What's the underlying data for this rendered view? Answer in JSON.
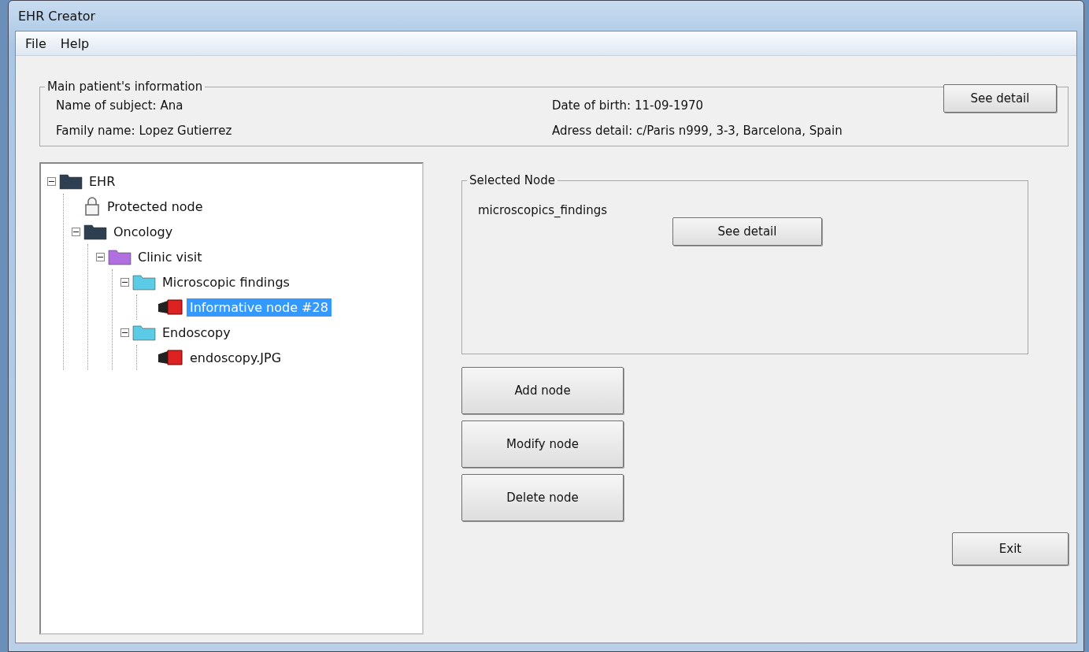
{
  "window": {
    "title": "EHR Creator"
  },
  "menu": [
    {
      "label": "File"
    },
    {
      "label": "Help"
    }
  ],
  "patient_info": {
    "title": "Main patient's information",
    "fields": [
      {
        "label": "Name of subject: Ana"
      },
      {
        "label": "Date of birth: 11-09-1970"
      },
      {
        "label": "Family name: Lopez Gutierrez"
      },
      {
        "label": "Adress detail: c/Paris n999, 3-3, Barcelona, Spain"
      }
    ],
    "button": "See detail"
  },
  "tree": [
    {
      "label": "EHR",
      "kind": "folder",
      "color": "#2f3f52",
      "expanded": true,
      "selected": false,
      "children": [
        {
          "label": "Protected node",
          "kind": "protected",
          "selected": false
        },
        {
          "label": "Oncology",
          "kind": "folder",
          "color": "#2f3f52",
          "expanded": true,
          "selected": false,
          "children": [
            {
              "label": "Clinic visit",
              "kind": "folder",
              "color": "#b070e0",
              "expanded": true,
              "selected": false,
              "children": [
                {
                  "label": "Microscopic findings",
                  "kind": "folder",
                  "color": "#5ccbe6",
                  "expanded": true,
                  "selected": false,
                  "children": [
                    {
                      "label": "Informative node #28",
                      "kind": "file",
                      "selected": true
                    }
                  ]
                },
                {
                  "label": "Endoscopy",
                  "kind": "folder",
                  "color": "#5ccbe6",
                  "expanded": true,
                  "selected": false,
                  "children": [
                    {
                      "label": "endoscopy.JPG",
                      "kind": "file",
                      "selected": false
                    }
                  ]
                }
              ]
            }
          ]
        }
      ]
    }
  ],
  "selected_node": {
    "title": "Selected Node",
    "value": "microscopics_findings",
    "button": "See detail"
  },
  "actions": [
    "Add node",
    "Modify node",
    "Delete node"
  ],
  "exit_button": "Exit"
}
